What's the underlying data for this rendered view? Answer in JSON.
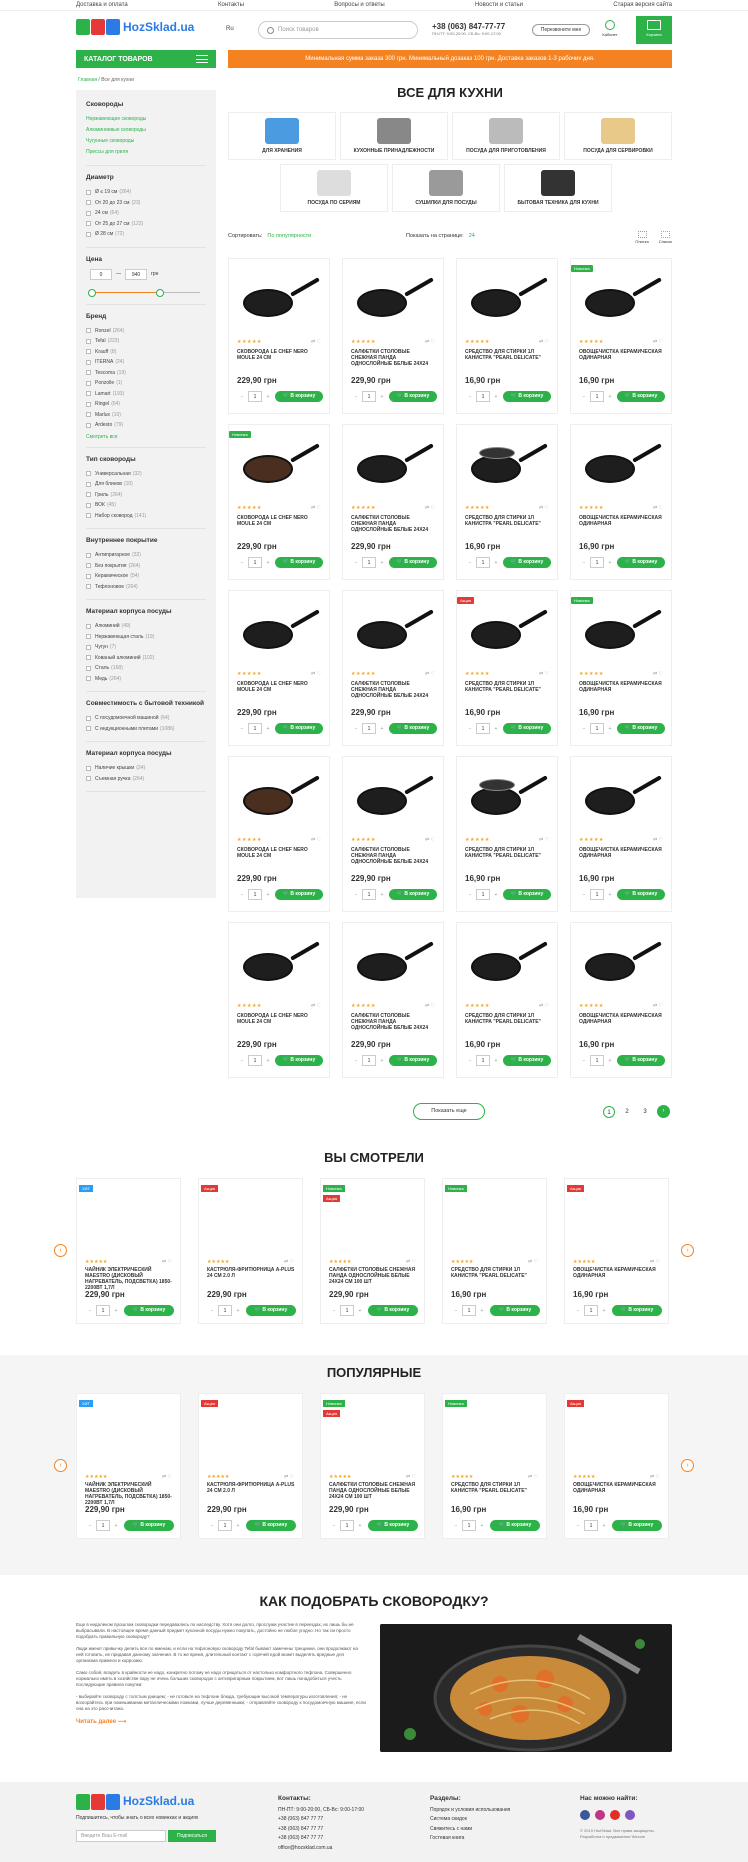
{
  "topnav": [
    "Доставка и оплата",
    "Контакты",
    "Вопросы и ответы",
    "Новости и статьи",
    "Старая версия сайта"
  ],
  "header": {
    "logo": "HozSklad.ua",
    "lang": "Ru",
    "search_placeholder": "Поиск товаров",
    "phone": "+38 (063) 847-77-77",
    "hours": "ПН-ПТ: 9:00-20:00, СБ-Вс: 9:00-17:00",
    "call_button": "Перезвоните мне",
    "cabinet": "Кабинет",
    "cart": "Корзина",
    "cart_count": "0"
  },
  "catalog_button": "КАТАЛОГ ТОВАРОВ",
  "promo": "Минимальная сумма заказа 300 грн. Минимальный дозаказ 100 грн. Доставка заказов 1-3 рабочих дня.",
  "breadcrumb": {
    "home": "Главная",
    "current": "/ Все для кухни"
  },
  "sidebar": {
    "skovorody": {
      "title": "Сковороды",
      "links": [
        "Нержавеющие сковороды",
        "Алюминиевые сковороды",
        "Чугунные сковороды",
        "Прессы для гриля"
      ]
    },
    "diameter": {
      "title": "Диаметр",
      "items": [
        [
          "Ø ≤ 19 см",
          "(264)"
        ],
        [
          "От 20 до 23 см",
          "(23)"
        ],
        [
          "24 см",
          "(64)"
        ],
        [
          "От 25 до 27 см",
          "(122)"
        ],
        [
          "Ø 28 см",
          "(72)"
        ]
      ]
    },
    "price": {
      "title": "Цена",
      "from": "0",
      "to": "940",
      "unit": "грн"
    },
    "brand": {
      "title": "Бренд",
      "items": [
        [
          "Ronzel",
          "(264)"
        ],
        [
          "Tefal",
          "(223)"
        ],
        [
          "Krauff",
          "(8)"
        ],
        [
          "ITERNA",
          "(24)"
        ],
        [
          "Tescoma",
          "(19)"
        ],
        [
          "Ponzolle",
          "(1)"
        ],
        [
          "Lamart",
          "(193)"
        ],
        [
          "Ringel",
          "(64)"
        ],
        [
          "Marlux",
          "(10)"
        ],
        [
          "Ardesto",
          "(79)"
        ]
      ],
      "see_all": "Смотреть все"
    },
    "type": {
      "title": "Тип сковороды",
      "items": [
        [
          "Универсальная",
          "(32)"
        ],
        [
          "Для блинов",
          "(10)"
        ],
        [
          "Гриль",
          "(264)"
        ],
        [
          "ВОК",
          "(45)"
        ],
        [
          "Набор сковород",
          "(141)"
        ]
      ]
    },
    "coating": {
      "title": "Внутреннее покрытие",
      "items": [
        [
          "Антипригарное",
          "(32)"
        ],
        [
          "Без покрытия",
          "(264)"
        ],
        [
          "Керамическое",
          "(54)"
        ],
        [
          "Тефлоновое",
          "(264)"
        ]
      ]
    },
    "material": {
      "title": "Материал корпуса посуды",
      "items": [
        [
          "Алюминий",
          "(49)"
        ],
        [
          "Нержавеющая сталь",
          "(19)"
        ],
        [
          "Чугун",
          "(7)"
        ],
        [
          "Кованый алюминий",
          "(102)"
        ],
        [
          "Сталь",
          "(168)"
        ],
        [
          "Медь",
          "(264)"
        ]
      ]
    },
    "compat": {
      "title": "Совместимость с бытовой техникой",
      "items": [
        [
          "С посудомоечной машиной",
          "(64)"
        ],
        [
          "С индукционными плитами",
          "(1086)"
        ]
      ]
    },
    "material2": {
      "title": "Материал корпуса посуды",
      "items": [
        [
          "Наличие крышки",
          "(24)"
        ],
        [
          "Съемная ручка",
          "(264)"
        ]
      ]
    }
  },
  "page_title": "ВСЕ ДЛЯ КУХНИ",
  "categories": [
    "ДЛЯ ХРАНЕНИЯ",
    "КУХОННЫЕ ПРИНАДЛЕЖНОСТИ",
    "ПОСУДА ДЛЯ ПРИГОТОВЛЕНИЯ",
    "ПОСУДА ДЛЯ СЕРВИРОВКИ",
    "ПОСУДА ПО СЕРИЯМ",
    "СУШИЛКИ ДЛЯ ПОСУДЫ",
    "БЫТОВАЯ ТЕХНИКА ДЛЯ КУХНИ"
  ],
  "sort": {
    "label": "Сортировать:",
    "value": "По популярности",
    "perpage_label": "Показать на странице:",
    "perpage": "24",
    "view_grid": "Плитка",
    "view_list": "Список"
  },
  "product_names": [
    "СКОВОРОДА LE CHEF NERO MOULE 24 СМ",
    "САЛФЕТКИ СТОЛОВЫЕ СНЕЖНАЯ ПАНДА ОДНОСЛОЙНЫЕ БЕЛЫЕ 24Х24",
    "СРЕДСТВО ДЛЯ СТИРКИ 1Л КАНИСТРА \"PEARL DELICATE\"",
    "ОВОЩЕЧИСТКА КЕРАМИЧЕСКАЯ ОДИНАРНАЯ"
  ],
  "product_prices": [
    "229,90 грн",
    "229,90 грн",
    "16,90 грн",
    "16,90 грн"
  ],
  "badges": {
    "new": "Новинка",
    "sale": "Акция",
    "hit": "ХИТ"
  },
  "buy_label": "В корзину",
  "qty_default": "1",
  "show_more": "Показать еще",
  "pages": [
    "1",
    "2",
    "3"
  ],
  "viewed_title": "ВЫ СМОТРЕЛИ",
  "popular_title": "ПОПУЛЯРНЫЕ",
  "slider_products": [
    {
      "name": "ЧАЙНИК ЭЛЕКТРИЧЕСКИЙ MAESTRO (ДИСКОВЫЙ НАГРЕВАТЕЛЬ, ПОДСВЕТКА) 1850-2200ВТ 1,7Л",
      "price": "229,90 грн"
    },
    {
      "name": "КАСТРЮЛЯ-ФРИТЮРНИЦА A-PLUS 24 СМ 2.0 Л",
      "price": "229,90 грн"
    },
    {
      "name": "САЛФЕТКИ СТОЛОВЫЕ СНЕЖНАЯ ПАНДА ОДНОСЛОЙНЫЕ БЕЛЫЕ 24Х24 СМ 100 ШТ",
      "price": "229,90 грн"
    },
    {
      "name": "СРЕДСТВО ДЛЯ СТИРКИ 1Л КАНИСТРА \"PEARL DELICATE\"",
      "price": "16,90 грн"
    },
    {
      "name": "ОВОЩЕЧИСТКА КЕРАМИЧЕСКАЯ ОДИНАРНАЯ",
      "price": "16,90 грн"
    }
  ],
  "howto": {
    "title": "КАК ПОДОБРАТЬ СКОВОРОДКУ?",
    "p1": "Еще в недалеком прошлом сковородки передавались по наследству. Хотя они долго, прослужи участие в переездах, их лишь бы не выбрасывали. В настоящее время данный предмет кухонной посуды нужно покупать, достойно не любое угодно. Но так ли просто подобрать правильную сковороду?",
    "p2": "Люди имеют привычку делить все по именам, и если на тефлоновую сковороду Tefal бывают замечены трещинки, они продолжают на ней готовить, не придавая данному значения. В то же время, длительный контакт с горячей едой может выделять вредные для организма примеси и коррозию.",
    "p3": "Само собой, владеть в крайности не надо, конкретно потому не надо отрицаться от настолько комфортного тефлона. Совершенно нормально иметь в хозяйстве пару не очень больших сковородок с антипригарным покрытием, вот лишь понадобиться учесть последующие правила покупки:",
    "list": "- выбирайте сковороду с толстым днищем; - не готовьте на тефлоне блюда, требующие высокой температуры изготовления; - не возгорайтесь при помешивании металлическими ложками, лучше деревянными; - отправляйте сковороду к посудомоечную машине, если она на это рассчитана.",
    "read_more": "Читать далее"
  },
  "footer": {
    "subscribe_text": "Подпишитесь, чтобы знать о всех новинках и акциях",
    "email_placeholder": "Введите Ваш E-mail",
    "subscribe_button": "Подписаться",
    "contacts_title": "Контакты:",
    "contacts": [
      "ПН-ПТ: 9:00-20:00, СБ-Вс: 9:00-17:00",
      "+38 (063) 847 77 77",
      "+38 (063) 847 77 77",
      "+38 (063) 847 77 77",
      "office@hozsklad.com.ua"
    ],
    "sections_title": "Разделы:",
    "sections": [
      "Порядок и условия использования",
      "Система скидок",
      "Свяжитесь с нами",
      "Гостевая книга"
    ],
    "social_title": "Нас можно найти:",
    "copyright": "© 2019 HozSklad. Все права защищены.",
    "dev": "Разработка и продвижение Wezom"
  },
  "colors": {
    "green": "#2db24a",
    "orange": "#f58220",
    "red": "#e53935",
    "blue": "#2a7be4"
  }
}
